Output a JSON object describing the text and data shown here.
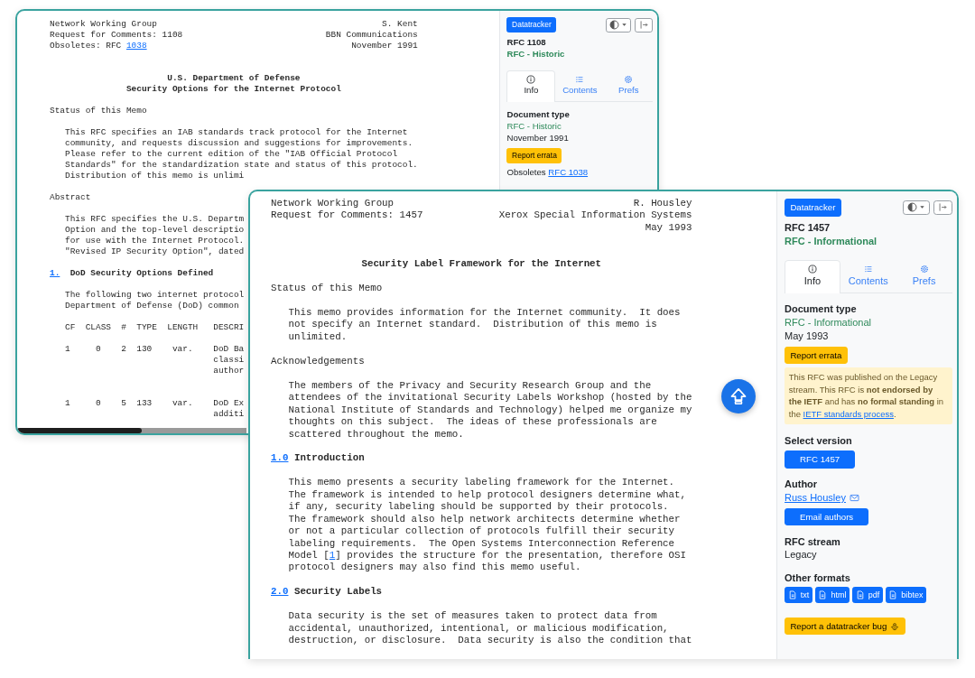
{
  "windows": [
    {
      "doc": {
        "blocks": [
          {
            "kind": "header",
            "left": [
              [
                {
                  "text": "Network Working Group"
                }
              ],
              [
                {
                  "text": "Request for Comments: 1108"
                }
              ],
              [
                {
                  "text": "Obsoletes: RFC "
                },
                {
                  "text": "1038",
                  "link": true
                }
              ]
            ],
            "right": [
              "S. Kent",
              "BBN Communications",
              "November 1991"
            ]
          },
          {
            "kind": "title",
            "lines": [
              "U.S. Department of Defense",
              "Security Options for the Internet Protocol"
            ]
          },
          {
            "kind": "heading",
            "text": "Status of this Memo"
          },
          {
            "kind": "para",
            "segments": [
              {
                "text": "This RFC specifies an IAB standards track protocol for the Internet\ncommunity, and requests discussion and suggestions for improvements.\nPlease refer to the current edition of the \"IAB Official Protocol\nStandards\" for the standardization state and status of this protocol.\nDistribution of this memo is unlimi"
              }
            ]
          },
          {
            "kind": "heading",
            "text": "Abstract"
          },
          {
            "kind": "para",
            "segments": [
              {
                "text": "This RFC specifies the U.S. Departm\nOption and the top-level descriptio\nfor use with the Internet Protocol.\n\"Revised IP Security Option\", dated"
              }
            ]
          },
          {
            "kind": "section",
            "number": "1.",
            "title": "DoD Security Options Defined"
          },
          {
            "kind": "para",
            "segments": [
              {
                "text": "The following two internet protocol\nDepartment of Defense (DoD) common"
              }
            ]
          },
          {
            "kind": "table",
            "header": "CF  CLASS  #  TYPE  LENGTH   DESCRI",
            "rows": [
              "1     0    2  130    var.    DoD Ba\n                             classi\n                             author",
              "1     0    5  133    var.    DoD Ex\n                             additi"
            ]
          }
        ]
      },
      "sidebar": {
        "brand_button": "Datatracker",
        "title": "RFC 1108",
        "status": "RFC - Historic",
        "tabs": [
          {
            "label": "Info",
            "selected": true
          },
          {
            "label": "Contents",
            "selected": false
          },
          {
            "label": "Prefs",
            "selected": false
          }
        ],
        "items": [
          {
            "kind": "heading",
            "text": "Document type"
          },
          {
            "kind": "status",
            "text": "RFC - Historic"
          },
          {
            "kind": "text",
            "text": "November 1991"
          },
          {
            "kind": "warning-button",
            "text": "Report errata"
          },
          {
            "kind": "link-line",
            "text": "Obsoletes",
            "link": "RFC 1038"
          }
        ]
      }
    },
    {
      "doc": {
        "blocks": [
          {
            "kind": "header",
            "left": [
              [
                {
                  "text": "Network Working Group"
                }
              ],
              [
                {
                  "text": "Request for Comments: 1457"
                }
              ]
            ],
            "right": [
              "R. Housley",
              "Xerox Special Information Systems",
              "May 1993"
            ]
          },
          {
            "kind": "title",
            "lines": [
              "Security Label Framework for the Internet"
            ]
          },
          {
            "kind": "heading",
            "text": "Status of this Memo"
          },
          {
            "kind": "para",
            "segments": [
              {
                "text": "This memo provides information for the Internet community.  It does\nnot specify an Internet standard.  Distribution of this memo is\nunlimited."
              }
            ]
          },
          {
            "kind": "heading",
            "text": "Acknowledgements"
          },
          {
            "kind": "para",
            "segments": [
              {
                "text": "The members of the Privacy and Security Research Group and the\nattendees of the invitational Security Labels Workshop (hosted by the\nNational Institute of Standards and Technology) helped me organize my\nthoughts on this subject.  The ideas of these professionals are\nscattered throughout the memo."
              }
            ]
          },
          {
            "kind": "section",
            "number": "1.0",
            "title": "Introduction"
          },
          {
            "kind": "para",
            "segments": [
              {
                "text": "This memo presents a security labeling framework for the Internet.\nThe framework is intended to help protocol designers determine what,\nif any, security labeling should be supported by their protocols.\nThe framework should also help network architects determine whether\nor not a particular collection of protocols fulfill their security\nlabeling requirements.  The Open Systems Interconnection Reference\nModel ["
              },
              {
                "text": "1",
                "link": true
              },
              {
                "text": "] provides the structure for the presentation, therefore OSI\nprotocol designers may also find this memo useful."
              }
            ]
          },
          {
            "kind": "section",
            "number": "2.0",
            "title": "Security Labels"
          },
          {
            "kind": "para",
            "segments": [
              {
                "text": "Data security is the set of measures taken to protect data from\naccidental, unauthorized, intentional, or malicious modification,\ndestruction, or disclosure.  Data security is also the condition that"
              }
            ]
          }
        ]
      },
      "sidebar": {
        "brand_button": "Datatracker",
        "title": "RFC 1457",
        "status": "RFC - Informational",
        "tabs": [
          {
            "label": "Info",
            "selected": true
          },
          {
            "label": "Contents",
            "selected": false
          },
          {
            "label": "Prefs",
            "selected": false
          }
        ],
        "items": [
          {
            "kind": "heading",
            "text": "Document type"
          },
          {
            "kind": "status",
            "text": "RFC - Informational"
          },
          {
            "kind": "text",
            "text": "May 1993"
          },
          {
            "kind": "warning-button",
            "text": "Report errata"
          },
          {
            "kind": "notice",
            "message": "This RFC was published on the Legacy stream. This RFC is **not endorsed by the IETF** and has **no formal standing** in the ",
            "link": "IETF standards process",
            "after": "."
          },
          {
            "kind": "heading",
            "text": "Select version"
          },
          {
            "kind": "primary-button",
            "text": "RFC 1457"
          },
          {
            "kind": "heading",
            "text": "Author"
          },
          {
            "kind": "author",
            "text": "Russ Housley"
          },
          {
            "kind": "primary-button",
            "text": "Email authors"
          },
          {
            "kind": "heading",
            "text": "RFC stream"
          },
          {
            "kind": "text",
            "text": "Legacy"
          },
          {
            "kind": "heading",
            "text": "Other formats"
          },
          {
            "kind": "formats",
            "items": [
              "txt",
              "html",
              "pdf",
              "bibtex"
            ]
          },
          {
            "kind": "bug-button",
            "text": "Report a datatracker bug"
          }
        ]
      }
    }
  ]
}
